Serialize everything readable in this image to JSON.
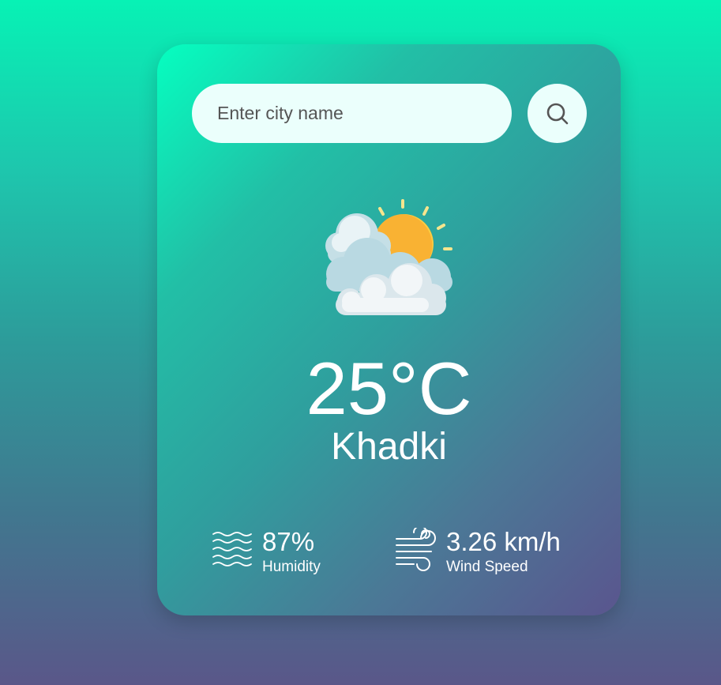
{
  "search": {
    "placeholder": "Enter city name"
  },
  "weather": {
    "icon": "sun-behind-clouds-icon",
    "temperature": "25°C",
    "city": "Khadki"
  },
  "details": {
    "humidity": {
      "icon": "humidity-waves-icon",
      "value": "87%",
      "label": "Humidity"
    },
    "wind": {
      "icon": "wind-icon",
      "value": "3.26 km/h",
      "label": "Wind Speed"
    }
  },
  "colors": {
    "accent": "#07f2b5",
    "card_end": "#5a558e",
    "input_bg": "#ebfffc",
    "text": "#ffffff"
  }
}
